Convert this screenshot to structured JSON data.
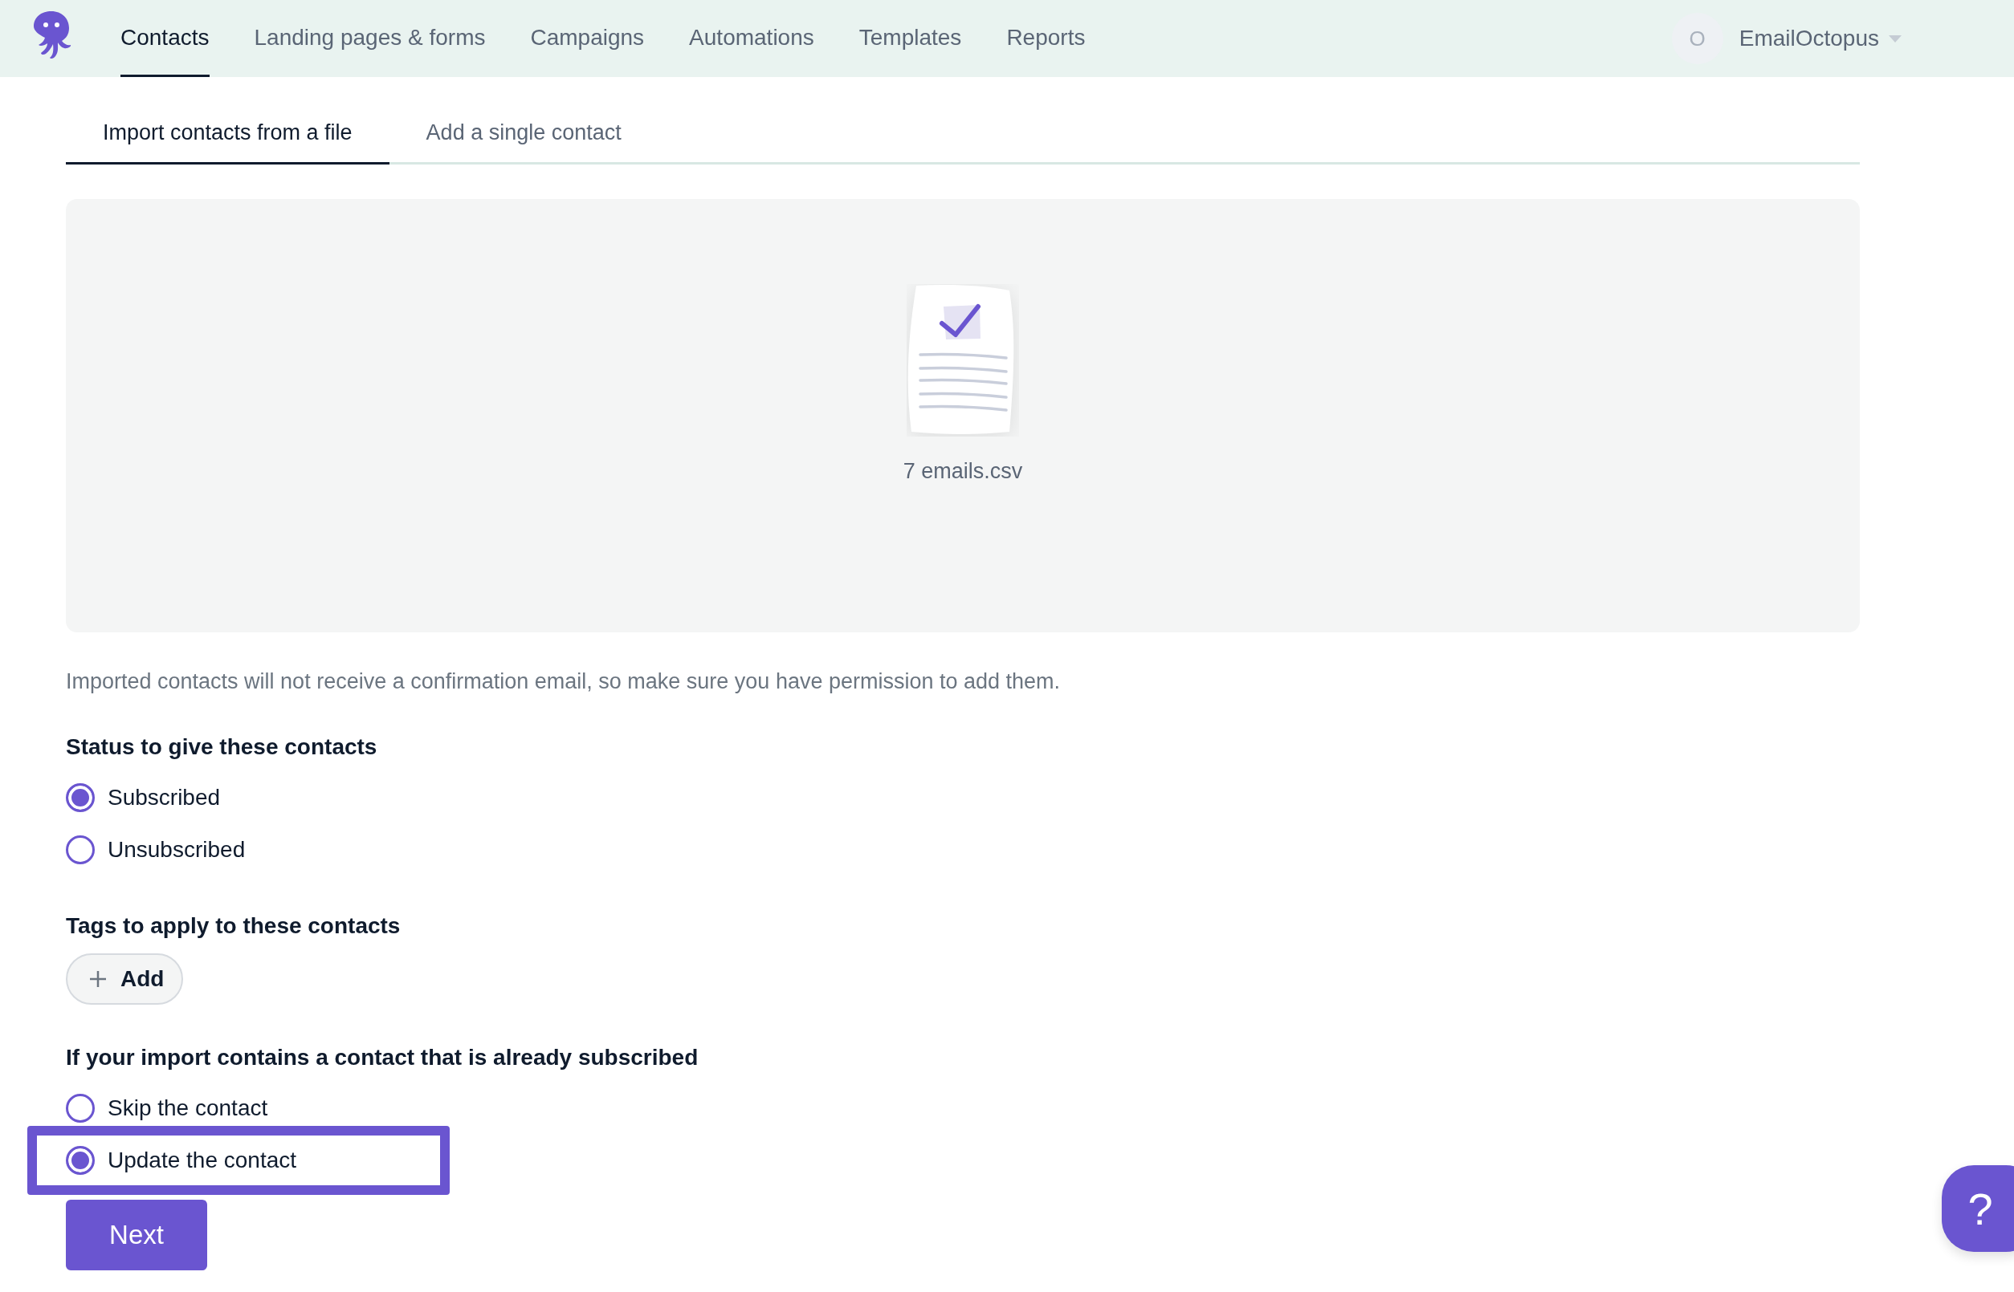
{
  "nav": {
    "items": [
      {
        "label": "Contacts",
        "selected": true
      },
      {
        "label": "Landing pages & forms",
        "selected": false
      },
      {
        "label": "Campaigns",
        "selected": false
      },
      {
        "label": "Automations",
        "selected": false
      },
      {
        "label": "Templates",
        "selected": false
      },
      {
        "label": "Reports",
        "selected": false
      }
    ],
    "account": {
      "avatar_initial": "O",
      "name": "EmailOctopus"
    }
  },
  "tabs": [
    {
      "label": "Import contacts from a file",
      "selected": true
    },
    {
      "label": "Add a single contact",
      "selected": false
    }
  ],
  "file": {
    "name": "7 emails.csv"
  },
  "notice": "Imported contacts will not receive a confirmation email, so make sure you have permission to add them.",
  "status_group": {
    "heading": "Status to give these contacts",
    "options": [
      {
        "label": "Subscribed",
        "selected": true,
        "highlighted": false
      },
      {
        "label": "Unsubscribed",
        "selected": false,
        "highlighted": false
      }
    ]
  },
  "tags": {
    "heading": "Tags to apply to these contacts",
    "add_button": "Add"
  },
  "existing_group": {
    "heading": "If your import contains a contact that is already subscribed",
    "options": [
      {
        "label": "Skip the contact",
        "selected": false,
        "highlighted": false
      },
      {
        "label": "Update the contact",
        "selected": true,
        "highlighted": true
      }
    ]
  },
  "next_button": "Next",
  "help_button": "?"
}
